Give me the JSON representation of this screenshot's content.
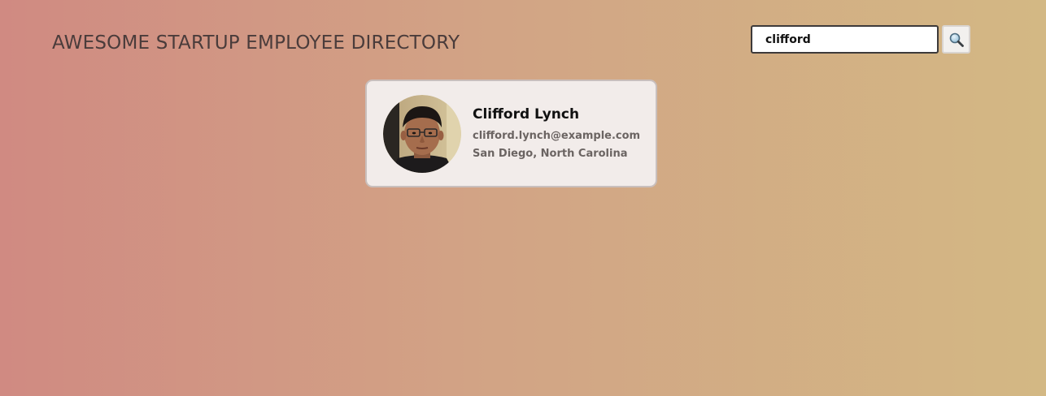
{
  "header": {
    "title": "AWESOME STARTUP EMPLOYEE DIRECTORY"
  },
  "search": {
    "value": "clifford",
    "button_icon": "magnifying-glass-icon"
  },
  "employees": [
    {
      "name": "Clifford Lynch",
      "email": "clifford.lynch@example.com",
      "location": "San Diego, North Carolina",
      "avatar_icon": "employee-photo"
    }
  ]
}
